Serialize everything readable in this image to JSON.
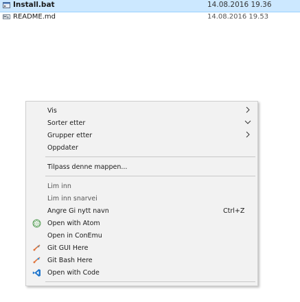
{
  "files": [
    {
      "name": "Install.bat",
      "date": "14.08.2016 19.36",
      "icon": "batch-file-icon"
    },
    {
      "name": "README.md",
      "date": "14.08.2016 19.53",
      "icon": "markdown-file-icon"
    }
  ],
  "context_menu": {
    "view": "Vis",
    "sort_by": "Sorter etter",
    "group_by": "Grupper etter",
    "refresh": "Oppdater",
    "customize": "Tilpass denne mappen...",
    "paste": "Lim inn",
    "paste_shortcut": "Lim inn snarvei",
    "undo_rename": "Angre Gi nytt navn",
    "undo_shortcut": "Ctrl+Z",
    "open_atom": "Open with Atom",
    "open_conemu": "Open in ConEmu",
    "git_gui": "Git GUI Here",
    "git_bash": "Git Bash Here",
    "open_code": "Open with Code"
  },
  "colors": {
    "selection": "#cce8ff",
    "menu_bg": "#f2f2f2",
    "separator": "#c8c8c8",
    "git": "#e0733b",
    "vscode": "#2277cc"
  }
}
